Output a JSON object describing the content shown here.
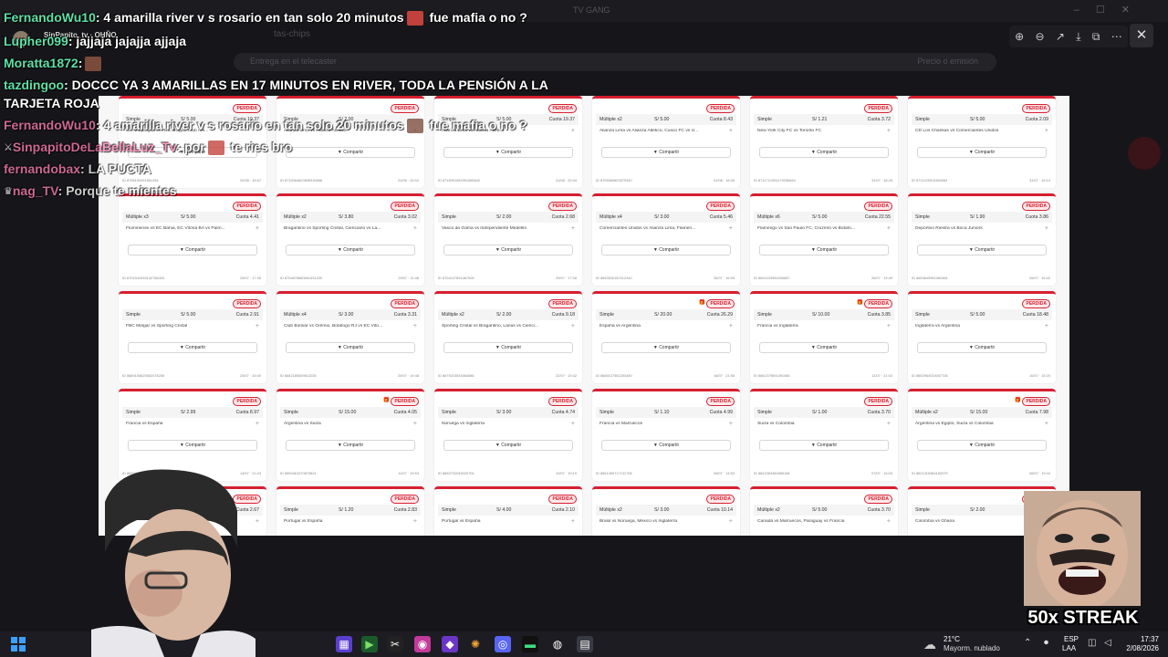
{
  "chat": [
    {
      "user": "FernandoWu10",
      "text": ": 4 amarilla river v s rosario en tan solo 20 minutos",
      "after": " fue mafia o no ?",
      "emote": true,
      "faded": false
    },
    {
      "user": "Lupher099",
      "text": ": jajjaja jajajja ajjaja",
      "after": "",
      "emote": false,
      "faded": false
    },
    {
      "user": "Moratta1872",
      "text": ":",
      "after": "",
      "emote": true,
      "faded": false
    },
    {
      "user": "tazdingoo",
      "text": ": DOCCC YA 3 AMARILLAS EN 17 MINUTOS EN RIVER, TODA LA PENSIÓN A LA",
      "after": "",
      "emote": false,
      "faded": false
    },
    {
      "user": "",
      "text": "TARJETA ROJA",
      "after": "",
      "emote": false,
      "faded": false
    },
    {
      "user": "FernandoWu10",
      "text": ": 4 amarilla river v s rosario en tan solo 20 minutos",
      "after": " fue mafia o no ?",
      "emote": true,
      "faded": true
    },
    {
      "user": "SinpapitoDeLaBellaLuz_Tv",
      "text": ": por",
      "after": " te ries bro",
      "emote": true,
      "faded": true
    },
    {
      "user": "fernandobax",
      "text": ": LA PUCTA",
      "after": "",
      "emote": false,
      "faded": true
    },
    {
      "user": "nag_TV",
      "text": ": Porque te mientes",
      "after": "",
      "emote": false,
      "faded": true
    }
  ],
  "bubble_tag": "SinPapito_tv · OHÑO",
  "bg": {
    "title": "TV GANG",
    "addr": "tas-chips",
    "search_placeholder": "Entrega en el telecaster",
    "search_right": "Precio o emisión"
  },
  "viewer_tools": [
    "⊕",
    "⊖",
    "↗",
    "⤓",
    "⧉",
    "⋯"
  ],
  "viewer_close": "✕",
  "cards": [
    {
      "type": "Simple",
      "stake": "S/ 5.00",
      "cuota": "Cuota 19.37",
      "match": "CD Moquegua vs FBC Melgar, Club Am...",
      "id": "ID 8798159491561284",
      "date": "02/08 · 15:57",
      "gift": false
    },
    {
      "type": "Simple",
      "stake": "S/ 2.00",
      "cuota": "",
      "match": "Alianza Lima vs Alianza Atlético",
      "id": "ID 8715084820835915656",
      "date": "01/08 · 20:02",
      "gift": false
    },
    {
      "type": "Simple",
      "stake": "S/ 5.00",
      "cuota": "Cuota 19.37",
      "match": "Alianza Lima vs Alianza Atlético",
      "id": "ID 8715091082991565642",
      "date": "01/08 · 20:04",
      "gift": false
    },
    {
      "type": "Múltiple x2",
      "stake": "S/ 5.00",
      "cuota": "Cuota 8.43",
      "match": "Alianza Lima vs Alianza Atlético, Cusco FC vs U...",
      "id": "ID 8708369603379320",
      "date": "01/08 · 18:35",
      "gift": false
    },
    {
      "type": "Simple",
      "stake": "S/ 1.21",
      "cuota": "Cuota 3.72",
      "match": "New York City FC vs Toronto FC",
      "id": "ID 8711712004179256864",
      "date": "31/07 · 18:26",
      "gift": false
    },
    {
      "type": "Simple",
      "stake": "S/ 5.00",
      "cuota": "Cuota 2.09",
      "match": "CD Los Chankas vs Comerciantes Unidos",
      "id": "ID 8711225513460084",
      "date": "31/07 · 15:10",
      "gift": false
    },
    {
      "type": "Múltiple x3",
      "stake": "S/ 5.00",
      "cuota": "Cuota 4.41",
      "match": "Fluminense vs EC Bahia, EC Vitória BA vs Palm...",
      "id": "ID 8704342839142758403",
      "date": "29/07 · 17:35",
      "gift": false
    },
    {
      "type": "Múltiple x2",
      "stake": "S/ 3.80",
      "cuota": "Cuota 3.02",
      "match": "Bragantino vs Sporting Cristal, Cienciano vs La...",
      "id": "ID 8704678880691531200",
      "date": "29/07 · 11:48",
      "gift": false
    },
    {
      "type": "Simple",
      "stake": "S/ 2.00",
      "cuota": "Cuota 2.68",
      "match": "Vasco da Gama vs Independiente Medellín",
      "id": "ID 8704247891467528",
      "date": "29/07 · 17:08",
      "gift": false
    },
    {
      "type": "Múltiple x4",
      "stake": "S/ 3.00",
      "cuota": "Cuota 5.46",
      "match": "Comerciantes Unidos vs Alianza Lima, Flamen...",
      "id": "ID 8693530187012240",
      "date": "26/07 · 16:59",
      "gift": false
    },
    {
      "type": "Múltiple x6",
      "stake": "S/ 5.00",
      "cuota": "Cuota 22.55",
      "match": "Flamengo vs Sao Paulo FC, Cruzeiro vs Botafo...",
      "id": "ID 8692103981534667",
      "date": "26/07 · 13:49",
      "gift": false
    },
    {
      "type": "Simple",
      "stake": "S/ 1.90",
      "cuota": "Cuota 3.86",
      "match": "Deportivo Riestra vs Boca Juniors",
      "id": "ID 8693640981982464",
      "date": "26/07 · 16:42",
      "gift": false
    },
    {
      "type": "Simple",
      "stake": "S/ 5.00",
      "cuota": "Cuota 2.91",
      "match": "FBC Melgar vs Sporting Cristal",
      "id": "ID 8689155825552478208",
      "date": "25/07 · 15:40",
      "gift": false
    },
    {
      "type": "Múltiple x4",
      "stake": "S/ 3.00",
      "cuota": "Cuota 3.31",
      "match": "Club Bolívar vs Grêmio, Botafogo RJ vs EC Vitó...",
      "id": "ID 8682180659813226",
      "date": "25/07 · 14:48",
      "gift": false
    },
    {
      "type": "Múltiple x2",
      "stake": "S/ 2.00",
      "cuota": "Cuota 9.18",
      "match": "Sporting Cristal vs Bragantino, Lanús vs Cienci...",
      "id": "ID 8679215531664586",
      "date": "22/07 · 19:42",
      "gift": false
    },
    {
      "type": "Simple",
      "stake": "S/ 20.00",
      "cuota": "Cuota 26.29",
      "match": "España vs Argentina",
      "id": "ID 8665137582253450",
      "date": "16/07 · 21:56",
      "gift": true
    },
    {
      "type": "Simple",
      "stake": "S/ 10.00",
      "cuota": "Cuota 3.85",
      "match": "Francia vs Inglaterra",
      "id": "ID 8661379591491086",
      "date": "11/07 · 21:03",
      "gift": true
    },
    {
      "type": "Simple",
      "stake": "S/ 5.00",
      "cuota": "Cuota 18.48",
      "match": "Inglaterra vs Argentina",
      "id": "ID 8652964033057728",
      "date": "10/07 · 15:20",
      "gift": false
    },
    {
      "type": "Simple",
      "stake": "S/ 2.99",
      "cuota": "Cuota 8.97",
      "match": "Francia vs España",
      "id": "ID 8658458",
      "date": "14/07 · 21:03",
      "gift": false
    },
    {
      "type": "Simple",
      "stake": "S/ 15.00",
      "cuota": "Cuota 4.05",
      "match": "Argentina vs Suiza",
      "id": "ID 8659461070879824",
      "date": "11/07 · 19:53",
      "gift": true
    },
    {
      "type": "Simple",
      "stake": "S/ 3.00",
      "cuota": "Cuota 4.74",
      "match": "Noruega vs Inglaterra",
      "id": "ID 8655732049020704",
      "date": "10/07 · 19:19",
      "gift": false
    },
    {
      "type": "Simple",
      "stake": "S/ 1.10",
      "cuota": "Cuota 4.99",
      "match": "Francia vs Marruecos",
      "id": "ID 8651459717131708",
      "date": "09/07 · 14:53",
      "gift": false
    },
    {
      "type": "Simple",
      "stake": "S/ 1.00",
      "cuota": "Cuota 3.70",
      "match": "Suiza vs Colombia",
      "id": "ID 8642363482855168",
      "date": "07/07 · 15:03",
      "gift": false
    },
    {
      "type": "Múltiple x2",
      "stake": "S/ 15.00",
      "cuota": "Cuota 7.98",
      "match": "Argentina vs Egipto, Suiza vs Colombia",
      "id": "ID 8621315384182079",
      "date": "06/07 · 19:42",
      "gift": true
    },
    {
      "type": "Simple",
      "stake": "",
      "cuota": "Cuota 2.67",
      "match": "",
      "id": "",
      "date": "",
      "gift": false
    },
    {
      "type": "Simple",
      "stake": "S/ 1.20",
      "cuota": "Cuota 2.83",
      "match": "Portugal vs España",
      "id": "",
      "date": "",
      "gift": false
    },
    {
      "type": "Simple",
      "stake": "S/ 4.00",
      "cuota": "Cuota 2.10",
      "match": "Portugal vs España",
      "id": "",
      "date": "",
      "gift": false
    },
    {
      "type": "Múltiple x2",
      "stake": "S/ 3.00",
      "cuota": "Cuota 10.14",
      "match": "Brasil vs Noruega, México vs Inglaterra",
      "id": "",
      "date": "",
      "gift": false
    },
    {
      "type": "Múltiple x2",
      "stake": "S/ 5.00",
      "cuota": "Cuota 3.70",
      "match": "Canadá vs Marruecos, Paraguay vs Francia",
      "id": "",
      "date": "",
      "gift": false
    },
    {
      "type": "Simple",
      "stake": "S/ 2.00",
      "cuota": "",
      "match": "Colombia vs Ghana",
      "id": "",
      "date": "",
      "gift": false
    }
  ],
  "card_badge": "PERDIDA",
  "share_label": "Compartir",
  "streak_label": "50x STREAK",
  "taskbar": {
    "weather_temp": "21°C",
    "weather_desc": "Mayorm. nublado",
    "lang1": "ESP",
    "lang2": "LAA",
    "time": "17:37",
    "date": "2/08/2026"
  },
  "colors": {
    "accent_red": "#d61f30",
    "chat_user": "#5fe0a8"
  }
}
